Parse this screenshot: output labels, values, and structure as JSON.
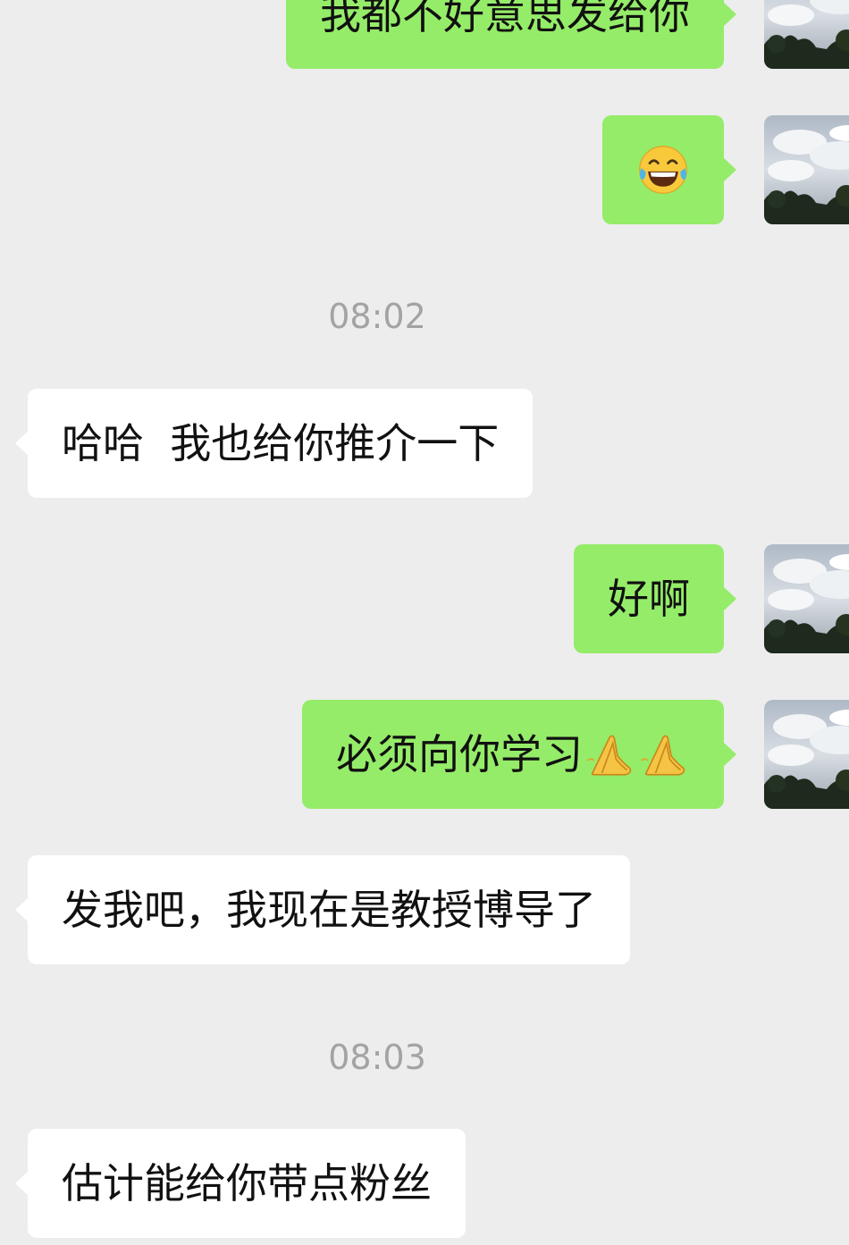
{
  "messages": [
    {
      "id": "m1",
      "direction": "out",
      "text": "我都不好意思发给你"
    },
    {
      "id": "m2",
      "direction": "out",
      "emoji": "tears-of-joy-emoji"
    },
    {
      "id": "t1",
      "type": "timestamp",
      "text": "08:02"
    },
    {
      "id": "m3",
      "direction": "in",
      "text": "哈哈  我也给你推介一下"
    },
    {
      "id": "m4",
      "direction": "out",
      "text": "好啊"
    },
    {
      "id": "m5",
      "direction": "out",
      "text": "必须向你学习",
      "trailing_emoji": [
        "folded-hands-emoji",
        "folded-hands-emoji"
      ]
    },
    {
      "id": "m6",
      "direction": "in",
      "text": "发我吧，我现在是教授博导了"
    },
    {
      "id": "t2",
      "type": "timestamp",
      "text": "08:03"
    },
    {
      "id": "m7",
      "direction": "in",
      "text": "估计能给你带点粉丝"
    }
  ],
  "colors": {
    "background": "#ededed",
    "outgoing_bubble": "#95ec69",
    "incoming_bubble": "#ffffff",
    "timestamp_text": "#a3a3a3"
  }
}
